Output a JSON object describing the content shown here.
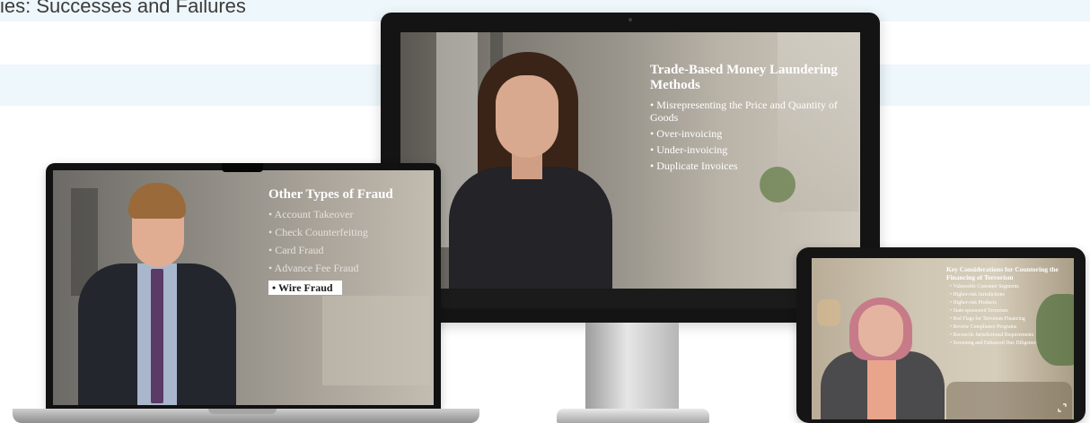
{
  "page": {
    "title": "ies: Successes and Failures"
  },
  "monitor": {
    "overlay_title": "Trade-Based Money Laundering Methods",
    "items": [
      "• Misrepresenting the Price and Quantity of Goods",
      "• Over-invoicing",
      "• Under-invoicing",
      "• Duplicate Invoices"
    ]
  },
  "laptop": {
    "overlay_title": "Other Types of Fraud",
    "items": [
      "• Account Takeover",
      "• Check Counterfeiting",
      "• Card Fraud",
      "• Advance Fee Fraud",
      "• Wire Fraud"
    ],
    "highlighted_index": 4
  },
  "tablet": {
    "overlay_title": "Key Considerations for Countering the Financing of Terrorism",
    "items": [
      "• Vulnerable Customer Segments",
      "• Higher-risk Jurisdictions",
      "• Higher-risk Products",
      "• State-sponsored Terrorism",
      "• Red Flags for Terrorism Financing",
      "• Review Compliance Programs",
      "• Reconcile Jurisdictional Requirements",
      "• Screening and Enhanced Due Diligence"
    ]
  },
  "colors": {
    "background_band": "#eef7fb",
    "device_frame": "#141414",
    "overlay_text": "#ffffff",
    "highlight_bg": "#ffffff"
  }
}
